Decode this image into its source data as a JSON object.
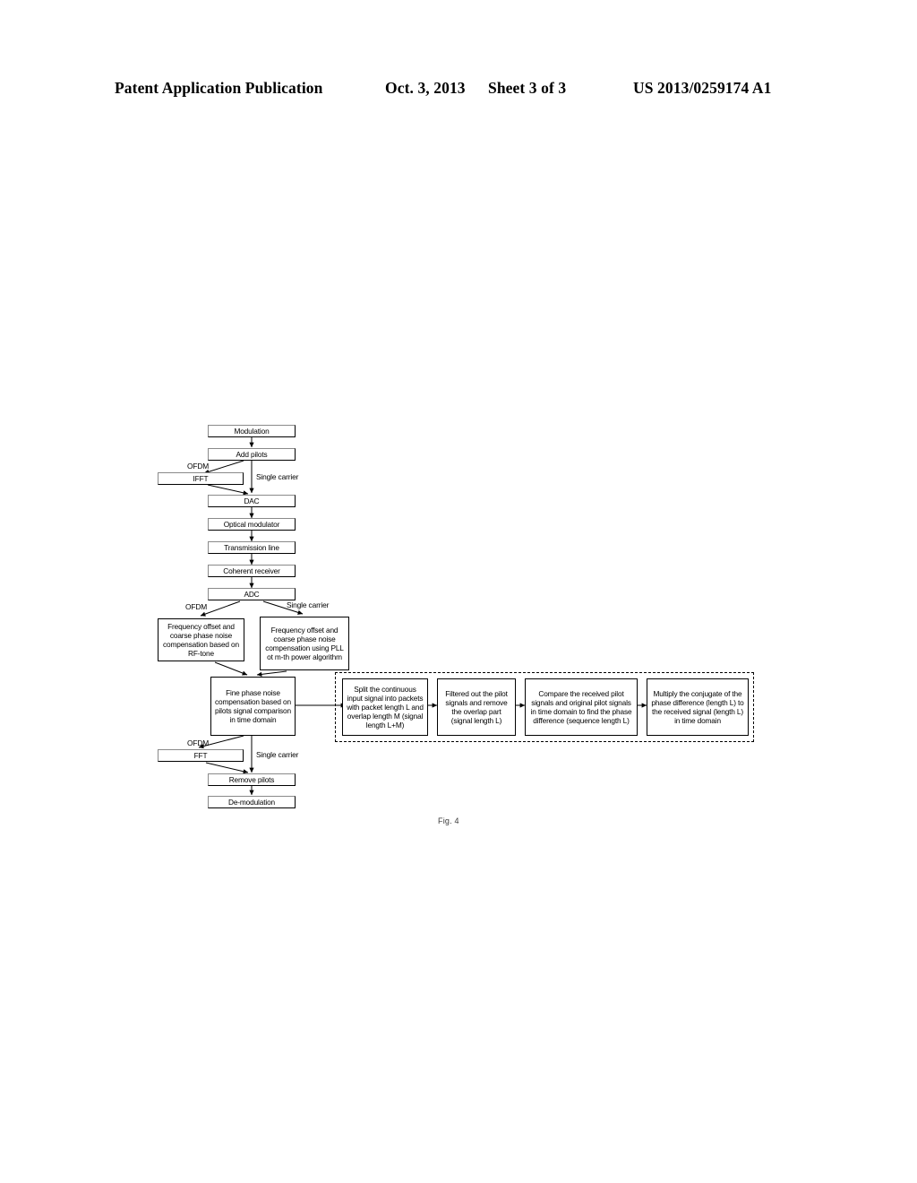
{
  "header": {
    "publication": "Patent Application Publication",
    "date": "Oct. 3, 2013",
    "sheet": "Sheet 3 of 3",
    "number": "US 2013/0259174 A1"
  },
  "figure": {
    "caption": "Fig. 4",
    "transmitter_chain": [
      {
        "id": "modulation",
        "label": "Modulation"
      },
      {
        "id": "add-pilots",
        "label": "Add pilots"
      },
      {
        "id": "ifft",
        "label": "IFFT"
      },
      {
        "id": "dac",
        "label": "DAC"
      },
      {
        "id": "optical-modulator",
        "label": "Optical modulator"
      },
      {
        "id": "transmission-line",
        "label": "Transmission line"
      },
      {
        "id": "coherent-receiver",
        "label": "Coherent receiver"
      },
      {
        "id": "adc",
        "label": "ADC"
      }
    ],
    "receiver_chain": [
      {
        "id": "freq-offset-rf-tone",
        "label": "Frequency offset and coarse phase noise compensation based on  RF-tone"
      },
      {
        "id": "freq-offset-pll",
        "label": "Frequency offset and coarse phase noise compensation using PLL ot m-th power algorithm"
      },
      {
        "id": "fine-phase-noise",
        "label": "Fine phase noise compensation based on  pilots signal comparison in time domain"
      },
      {
        "id": "fft",
        "label": "FFT"
      },
      {
        "id": "remove-pilots",
        "label": "Remove pilots"
      },
      {
        "id": "de-modulation",
        "label": "De-modulation"
      }
    ],
    "subprocess_steps": [
      {
        "id": "split-packets",
        "label": "Split the continuous input signal into packets with packet length L and overlap length M (signal length L+M)"
      },
      {
        "id": "filter-pilots",
        "label": "Filtered out the pilot signals and remove the overlap part (signal length L)"
      },
      {
        "id": "compare-pilots",
        "label": "Compare the received pilot signals and original pilot signals in time domain to find the phase difference (sequence length L)"
      },
      {
        "id": "multiply-conjugate",
        "label": "Multiply the conjugate of the phase difference (length L) to the received signal (length L) in time domain"
      }
    ],
    "branch_labels": {
      "tx_ofdm": "OFDM",
      "tx_single_carrier": "Single carrier",
      "rx_ofdm": "OFDM",
      "rx_single_carrier": "Single carrier",
      "out_ofdm": "OFDM",
      "out_single_carrier": "Single carrier"
    }
  }
}
